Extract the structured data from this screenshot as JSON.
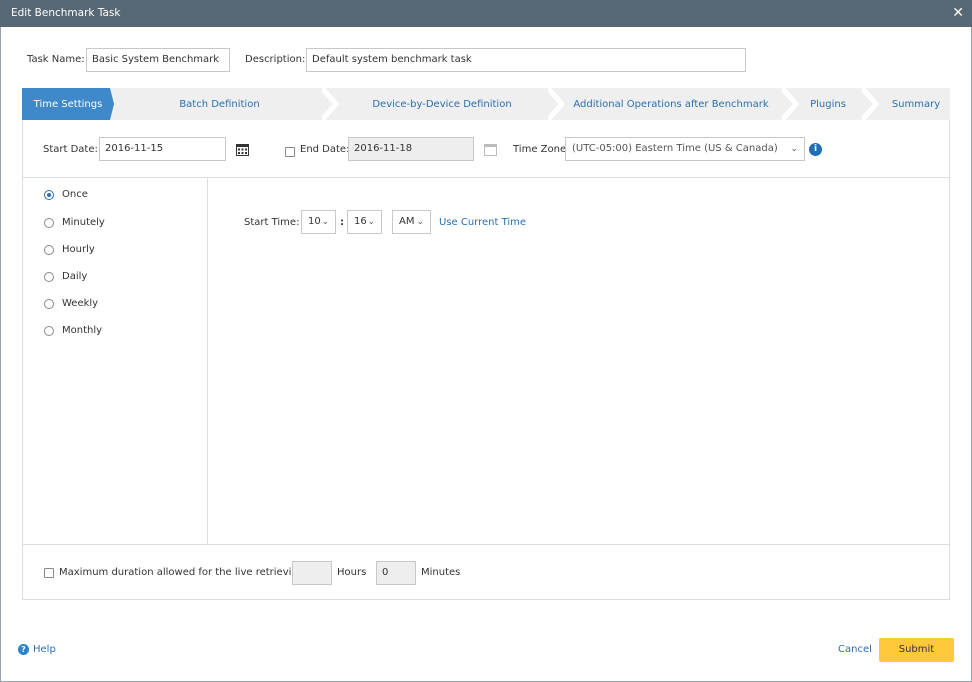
{
  "dialog": {
    "title": "Edit Benchmark Task"
  },
  "task": {
    "name_label": "Task Name:",
    "name_value": "Basic System Benchmark",
    "description_label": "Description:",
    "description_value": "Default system benchmark task"
  },
  "tabs": [
    {
      "label": "Time Settings"
    },
    {
      "label": "Batch Definition"
    },
    {
      "label": "Device-by-Device Definition"
    },
    {
      "label": "Additional Operations after Benchmark"
    },
    {
      "label": "Plugins"
    },
    {
      "label": "Summary"
    }
  ],
  "dates": {
    "start_label": "Start Date:",
    "start_value": "2016-11-15",
    "end_label": "End Date:",
    "end_value": "2016-11-18",
    "end_checked": false,
    "timezone_label": "Time Zone:",
    "timezone_value": "(UTC-05:00) Eastern Time (US & Canada)"
  },
  "frequency": {
    "options": [
      "Once",
      "Minutely",
      "Hourly",
      "Daily",
      "Weekly",
      "Monthly"
    ],
    "selected": "Once"
  },
  "start_time": {
    "label": "Start Time:",
    "hour": "10",
    "minute": "16",
    "separator": ":",
    "ampm": "AM",
    "use_current": "Use Current Time"
  },
  "duration": {
    "label": "Maximum duration allowed for the live retrieving:",
    "hours_value": "",
    "hours_label": "Hours",
    "minutes_value": "0",
    "minutes_label": "Minutes"
  },
  "footer": {
    "help": "Help",
    "cancel": "Cancel",
    "submit": "Submit"
  },
  "colors": {
    "accent": "#3f88c9",
    "titlebar": "#576874",
    "submit": "#fdc93a"
  }
}
